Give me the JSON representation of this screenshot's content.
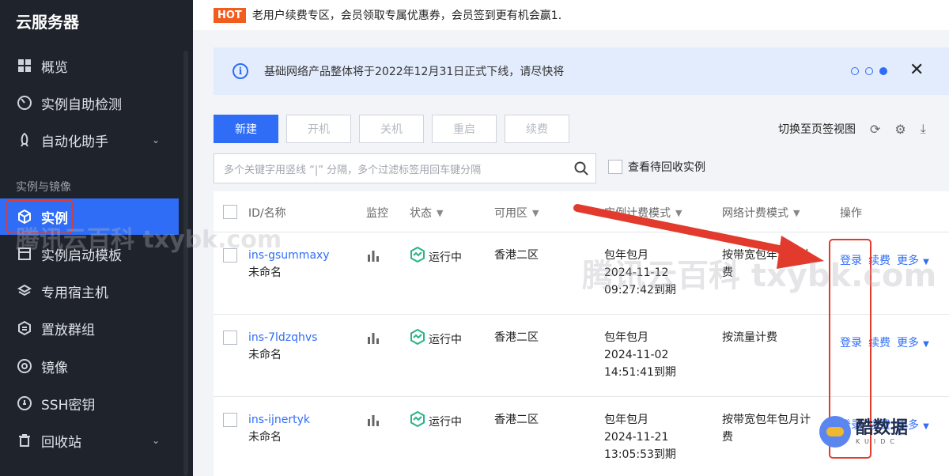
{
  "sidebar": {
    "title": "云服务器",
    "section": "实例与镜像",
    "items": [
      {
        "label": "概览",
        "icon": "grid-icon"
      },
      {
        "label": "实例自助检测",
        "icon": "gauge-icon"
      },
      {
        "label": "自动化助手",
        "icon": "rocket-icon",
        "expandable": true
      },
      {
        "label": "实例",
        "icon": "cube-icon",
        "active": true
      },
      {
        "label": "实例启动模板",
        "icon": "template-icon"
      },
      {
        "label": "专用宿主机",
        "icon": "layers-icon"
      },
      {
        "label": "置放群组",
        "icon": "group-icon"
      },
      {
        "label": "镜像",
        "icon": "disc-icon"
      },
      {
        "label": "SSH密钥",
        "icon": "key-icon"
      },
      {
        "label": "回收站",
        "icon": "trash-icon",
        "expandable": true
      }
    ]
  },
  "notice": {
    "badge": "HOT",
    "text": "老用户续费专区，会员领取专属优惠券，会员签到更有机会赢1."
  },
  "banner": {
    "text": "基础网络产品整体将于2022年12月31日正式下线，请尽快将",
    "active_dot": 3
  },
  "toolbar": {
    "buttons": [
      "新建",
      "开机",
      "关机",
      "重启",
      "续费"
    ],
    "switch_view": "切换至页签视图"
  },
  "search": {
    "placeholder": "多个关键字用竖线 “|” 分隔，多个过滤标签用回车键分隔",
    "recycle_label": "查看待回收实例"
  },
  "table": {
    "columns": [
      "ID/名称",
      "监控",
      "状态",
      "可用区",
      "实例计费模式",
      "网络计费模式",
      "操作"
    ],
    "rows": [
      {
        "id": "ins-gsummaxy",
        "name": "未命名",
        "status": "运行中",
        "zone": "香港二区",
        "billing": [
          "包年包月",
          "2024-11-12",
          "09:27:42到期"
        ],
        "network": [
          "按带宽包年包月计",
          "费"
        ],
        "ops": [
          "登录",
          "续费",
          "更多"
        ]
      },
      {
        "id": "ins-7ldzqhvs",
        "name": "未命名",
        "status": "运行中",
        "zone": "香港二区",
        "billing": [
          "包年包月",
          "2024-11-02",
          "14:51:41到期"
        ],
        "network": [
          "按流量计费",
          ""
        ],
        "ops": [
          "登录",
          "续费",
          "更多"
        ]
      },
      {
        "id": "ins-ijnertyk",
        "name": "未命名",
        "status": "运行中",
        "zone": "香港二区",
        "billing": [
          "包年包月",
          "2024-11-21",
          "13:05:53到期"
        ],
        "network": [
          "按带宽包年包月计",
          "费"
        ],
        "ops": [
          "登录",
          "续费",
          "更多"
        ]
      }
    ]
  },
  "watermark": {
    "text1": "腾讯云百科 txybk.com",
    "text2": "腾讯云百科 txybk.com",
    "logo_name": "酷数据",
    "logo_sub": "KUIDC"
  },
  "colors": {
    "accent": "#2f6df6",
    "sidebar_bg": "#1f232b",
    "hot": "#f25c1e",
    "annotation_red": "#e23b2e",
    "status_green": "#29b38a"
  }
}
